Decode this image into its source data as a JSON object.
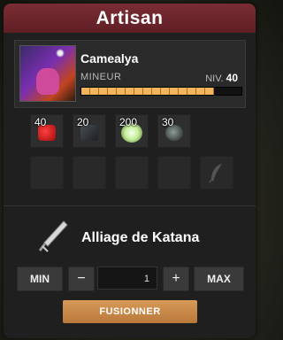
{
  "window": {
    "title": "Artisan"
  },
  "profession": {
    "name": "Camealya",
    "job": "MINEUR",
    "level_label": "NIV.",
    "level": "40",
    "xp_fraction": 0.83
  },
  "ingredients": [
    {
      "qty": "40",
      "icon": "red-gem-icon"
    },
    {
      "qty": "20",
      "icon": "dark-ore-icon"
    },
    {
      "qty": "200",
      "icon": "glowing-orb-icon"
    },
    {
      "qty": "30",
      "icon": "ore-icon"
    }
  ],
  "empty_slots": 4,
  "feather_slot_icon": "feather-icon",
  "recipe": {
    "item_name": "Alliage de Katana",
    "icon": "katana-alloy-icon"
  },
  "controls": {
    "min_label": "MIN",
    "minus_label": "−",
    "quantity": "1",
    "plus_label": "+",
    "max_label": "MAX",
    "fuse_label": "FUSIONNER"
  },
  "colors": {
    "header": "#6a242a",
    "accent": "#c98a48",
    "panel": "#1f1f1f"
  }
}
